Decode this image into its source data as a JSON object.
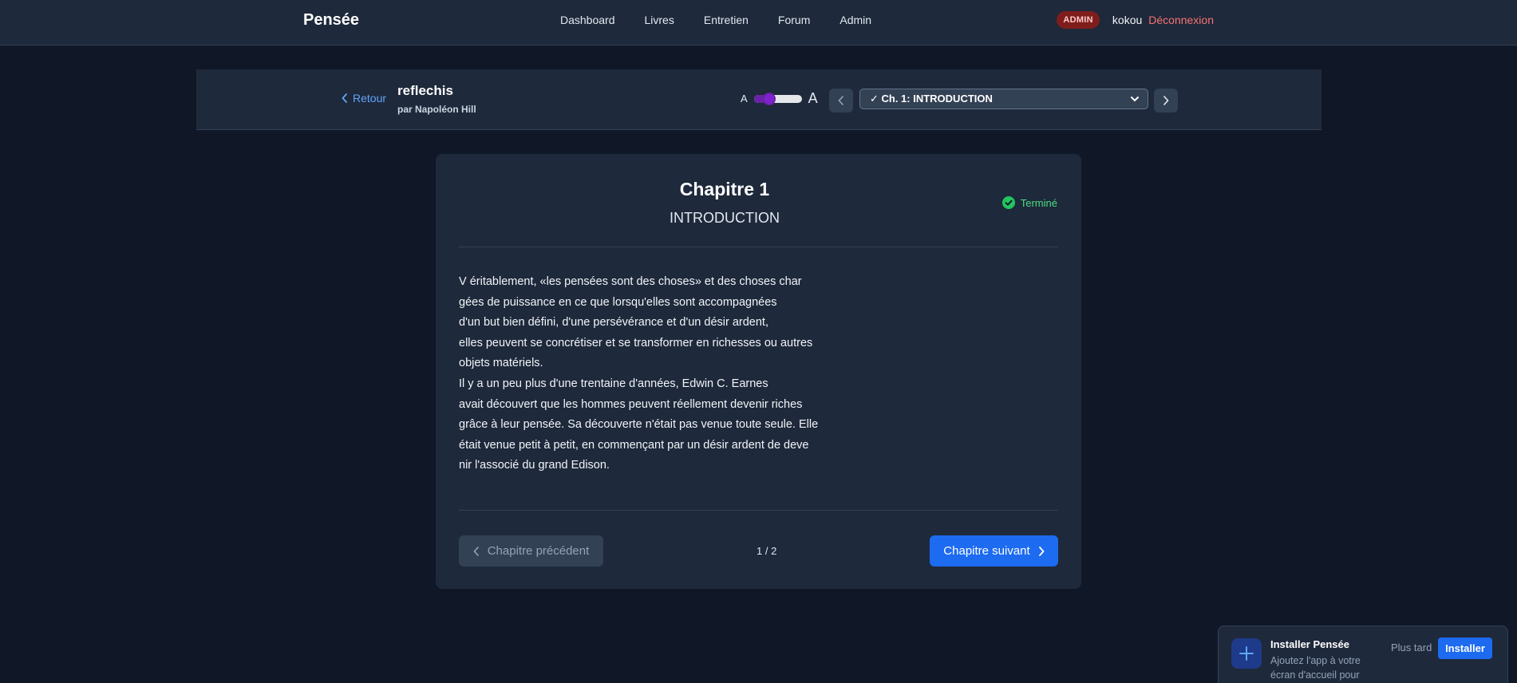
{
  "navbar": {
    "brand": "Pensée",
    "links": [
      "Dashboard",
      "Livres",
      "Entretien",
      "Forum",
      "Admin"
    ],
    "badge": "ADMIN",
    "username": "kokou",
    "logout": "Déconnexion"
  },
  "reader": {
    "back_label": "Retour",
    "book_title": "reflechis",
    "book_author": "par Napoléon Hill",
    "font_small": "A",
    "font_large": "A",
    "font_size_level": 0.25,
    "chapter_select": "✓ Ch. 1: INTRODUCTION"
  },
  "chapter": {
    "number": "Chapitre 1",
    "title": "INTRODUCTION",
    "status": "Terminé",
    "lines": [
      "V éritablement, «les pensées sont des choses» et des choses char",
      "gées de puissance en ce que lorsqu'elles sont accompagnées",
      "d'un but bien défini, d'une persévérance et d'un désir ardent,",
      "elles peuvent se concrétiser et se transformer en richesses ou autres",
      "objets matériels.",
      "Il y a un peu plus d'une trentaine d'années, Edwin C. Earnes",
      "avait découvert que les hommes peuvent réellement devenir riches",
      "grâce à leur pensée. Sa découverte n'était pas venue toute seule. Elle",
      "était venue petit à petit, en commençant par un désir ardent de deve",
      "nir l'associé du grand Edison."
    ],
    "prev_label": "Chapitre précédent",
    "pager": "1 / 2",
    "next_label": "Chapitre suivant"
  },
  "install": {
    "title": "Installer Pensée",
    "description": "Ajoutez l'app à votre écran d'accueil pour",
    "later": "Plus tard",
    "install": "Installer"
  },
  "colors": {
    "background": "#101828",
    "panel": "#1e293b",
    "accent": "#1d6bf0",
    "success": "#4ade80",
    "danger": "#f87171"
  }
}
